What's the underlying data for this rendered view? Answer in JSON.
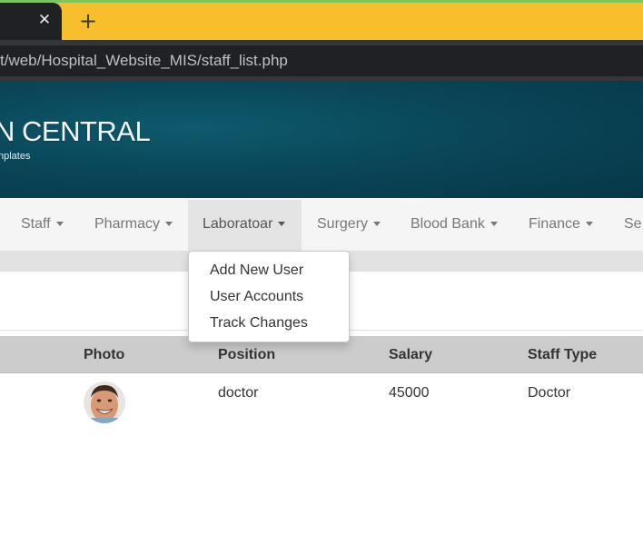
{
  "browser": {
    "tab_close_glyph": "✕",
    "new_tab_glyph": "+",
    "url": "t/web/Hospital_Website_MIS/staff_list.php"
  },
  "banner": {
    "brand": "N CENTRAL",
    "tagline": "nplates"
  },
  "nav": {
    "items": [
      {
        "label": "Staff"
      },
      {
        "label": "Pharmacy"
      },
      {
        "label": "Laboratoar"
      },
      {
        "label": "Surgery"
      },
      {
        "label": "Blood Bank"
      },
      {
        "label": "Finance"
      },
      {
        "label": "Se"
      }
    ],
    "active_index": 2
  },
  "dropdown": {
    "items": [
      "Add New User",
      "User Accounts",
      "Track Changes"
    ]
  },
  "table": {
    "headers": [
      "Photo",
      "Position",
      "Salary",
      "Staff Type"
    ],
    "rows": [
      {
        "photo": "doctor-avatar",
        "position": "doctor",
        "salary": "45000",
        "staff_type": "Doctor"
      }
    ]
  },
  "colors": {
    "tab_strip": "#f8bf2c",
    "banner": "#0a4659",
    "header_row": "#cccccc"
  }
}
